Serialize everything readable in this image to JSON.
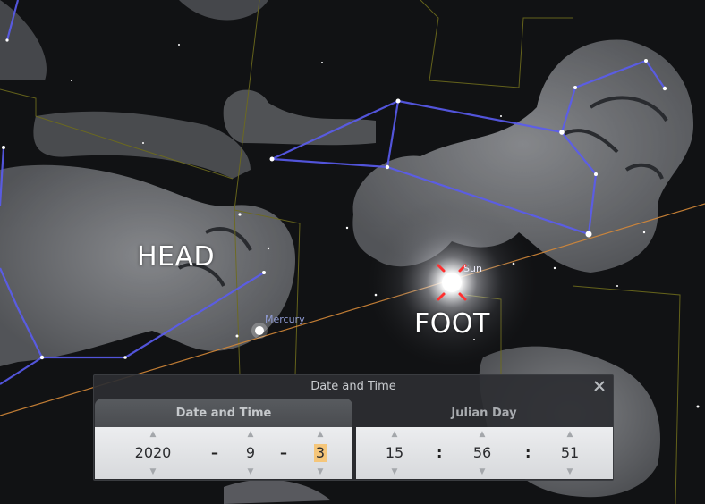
{
  "overlay": {
    "head_label": "HEAD",
    "foot_label": "FOOT"
  },
  "sky": {
    "mercury_label": "Mercury",
    "sun_label": "Sun",
    "colors": {
      "background": "#111214",
      "constellation_lines": "#5a5cf0",
      "boundaries": "#6e6b1c",
      "ecliptic": "#d48838",
      "artwork": "#8a8b8e"
    }
  },
  "dialog": {
    "title": "Date and Time",
    "close_icon": "close-icon",
    "tabs": [
      {
        "label": "Date and Time",
        "active": true
      },
      {
        "label": "Julian Day",
        "active": false
      }
    ],
    "date": {
      "year": "2020",
      "month": "9",
      "day": "3",
      "separator": "–"
    },
    "time": {
      "hour": "15",
      "minute": "56",
      "second": "51",
      "separator": ":"
    }
  }
}
